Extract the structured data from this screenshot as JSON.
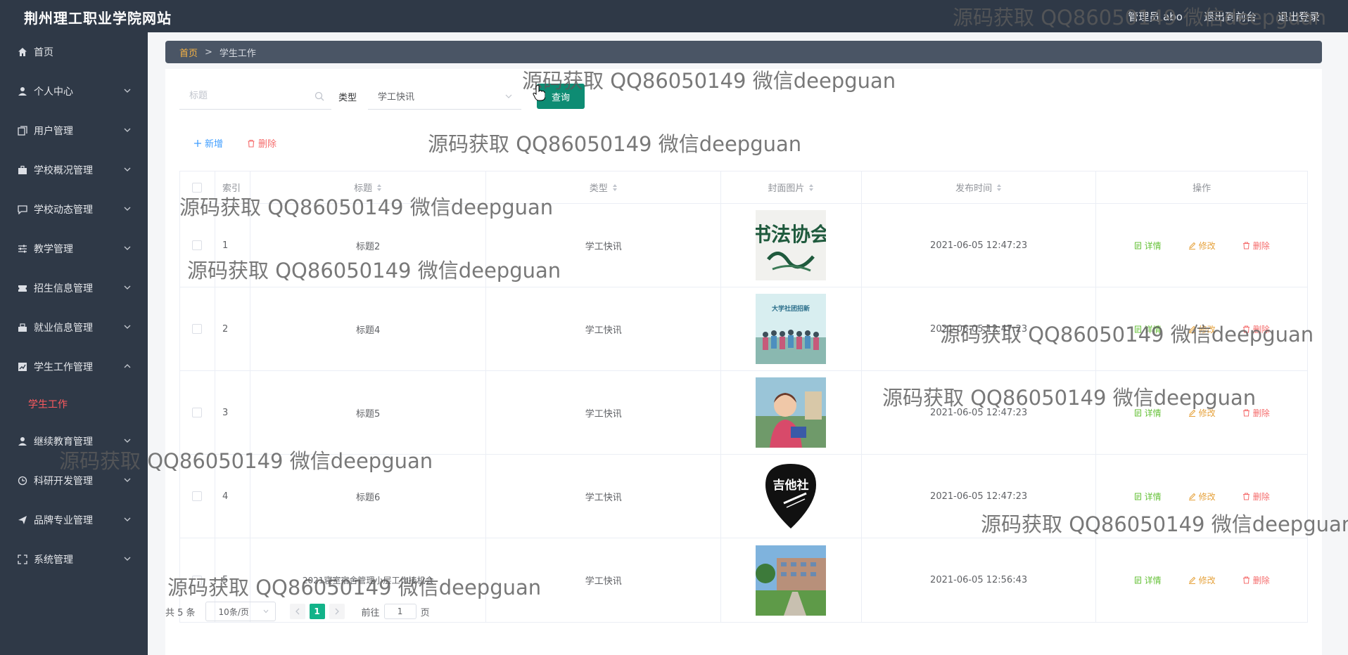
{
  "header": {
    "site_title": "荆州理工职业学院网站",
    "user": "管理员 abo",
    "back_to_front": "退出到前台",
    "logout": "退出登录"
  },
  "sidebar": {
    "items": [
      {
        "label": "首页",
        "icon": "home-icon"
      },
      {
        "label": "个人中心",
        "icon": "user-icon"
      },
      {
        "label": "用户管理",
        "icon": "copy-icon"
      },
      {
        "label": "学校概况管理",
        "icon": "briefcase-icon"
      },
      {
        "label": "学校动态管理",
        "icon": "chat-icon"
      },
      {
        "label": "教学管理",
        "icon": "sliders-icon"
      },
      {
        "label": "招生信息管理",
        "icon": "ticket-icon"
      },
      {
        "label": "就业信息管理",
        "icon": "bike-icon"
      },
      {
        "label": "学生工作管理",
        "icon": "chart-icon"
      },
      {
        "label": "继续教育管理",
        "icon": "user-icon"
      },
      {
        "label": "科研开发管理",
        "icon": "clock-icon"
      },
      {
        "label": "品牌专业管理",
        "icon": "send-icon"
      },
      {
        "label": "系统管理",
        "icon": "fullscreen-icon"
      }
    ],
    "active_sub": "学生工作"
  },
  "breadcrumb": {
    "home": "首页",
    "sep": ">",
    "current": "学生工作"
  },
  "search": {
    "title_placeholder": "标题",
    "type_label": "类型",
    "type_value": "学工快讯",
    "query_button": "查询"
  },
  "actions": {
    "add": "新增",
    "delete": "删除"
  },
  "table": {
    "headers": {
      "index": "索引",
      "title": "标题",
      "type": "类型",
      "cover": "封面图片",
      "time": "发布时间",
      "ops": "操作"
    },
    "ops": {
      "detail": "详情",
      "edit": "修改",
      "delete": "删除"
    },
    "rows": [
      {
        "index": "1",
        "title": "标题2",
        "type": "学工快讯",
        "time": "2021-06-05 12:47:23",
        "thumb_text": "书法协会"
      },
      {
        "index": "2",
        "title": "标题4",
        "type": "学工快讯",
        "time": "2021-06-05 12:47:23",
        "thumb_text": "大学社团招新"
      },
      {
        "index": "3",
        "title": "标题5",
        "type": "学工快讯",
        "time": "2021-06-05 12:47:23",
        "thumb_text": ""
      },
      {
        "index": "4",
        "title": "标题6",
        "type": "学工快讯",
        "time": "2021-06-05 12:47:23",
        "thumb_text": "吉他社"
      },
      {
        "index": "5",
        "title": "2021寝室宿舍管理小层工作接机会",
        "type": "学工快讯",
        "time": "2021-06-05 12:56:43",
        "thumb_text": ""
      }
    ]
  },
  "pager": {
    "total": "共 5 条",
    "page_size": "10条/页",
    "current": "1",
    "goto": "前往",
    "goto_value": "1",
    "page": "页"
  },
  "watermark": "源码获取 QQ86050149 微信deepguan",
  "colors": {
    "sidebar": "#2f3947",
    "accent": "#0e8c73",
    "active": "#ff5a5f",
    "page_active": "#13b389"
  }
}
